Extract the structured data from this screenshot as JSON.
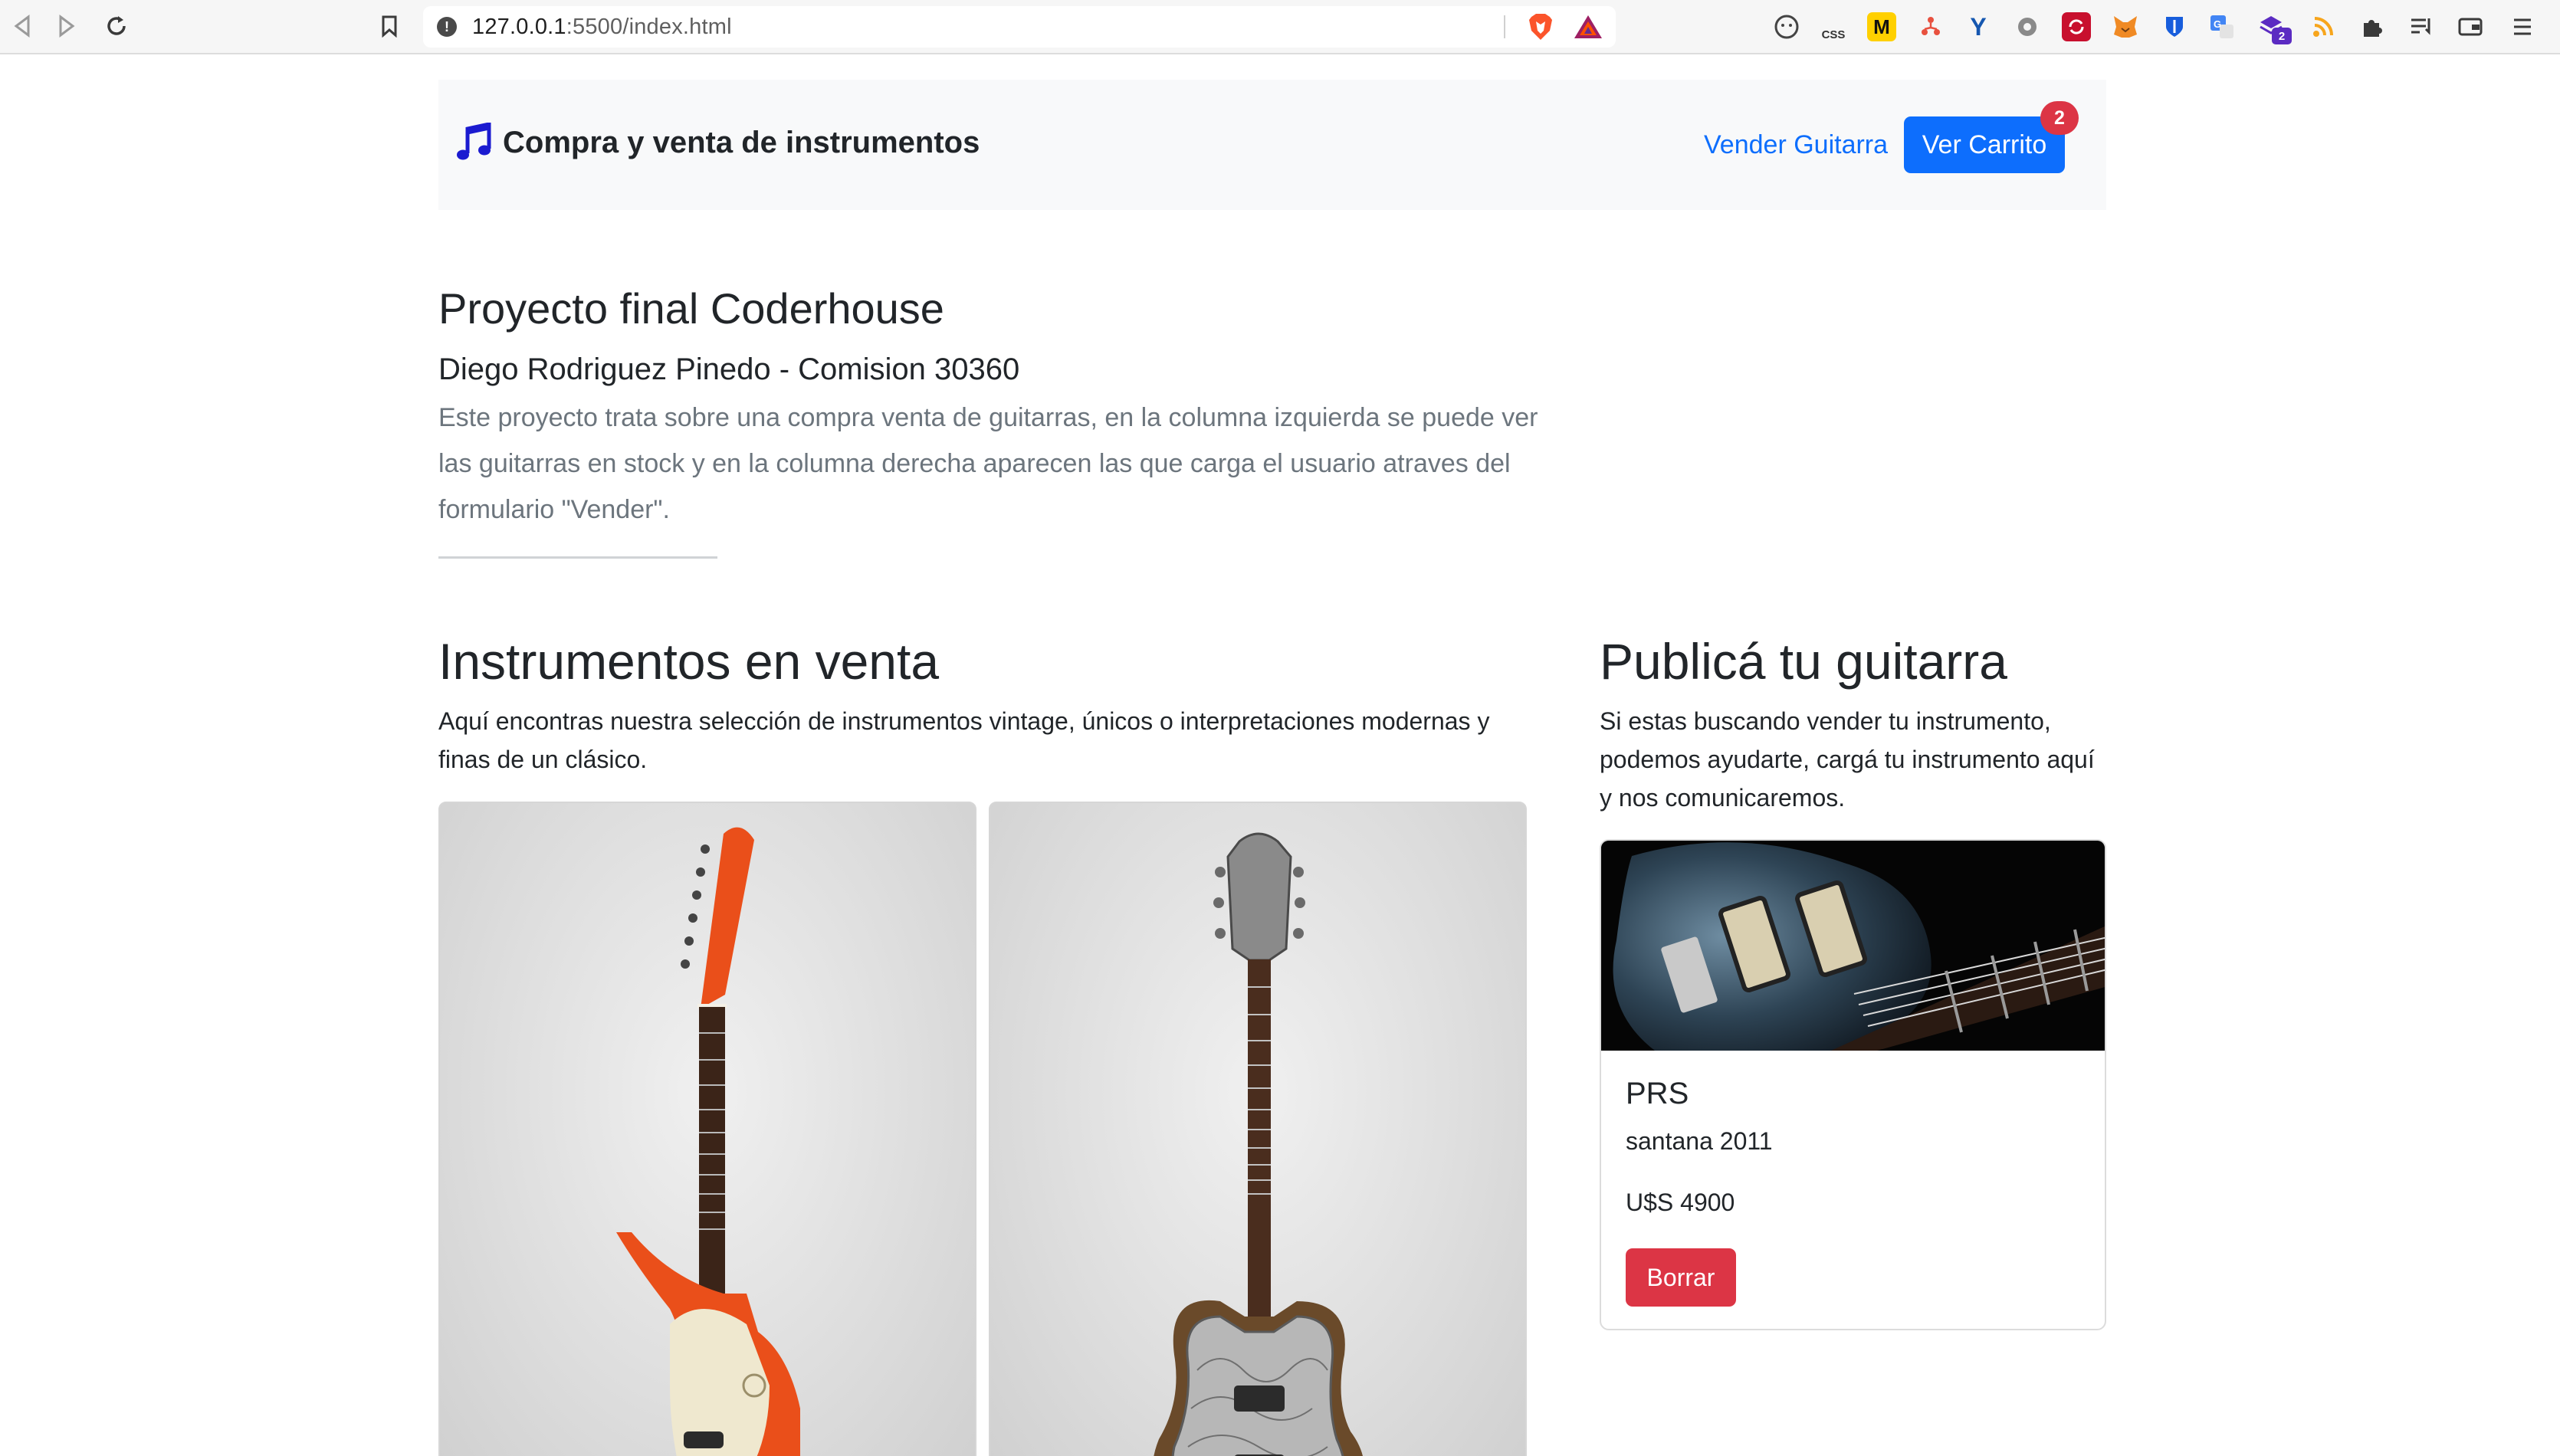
{
  "browser": {
    "url_host": "127.0.0.1",
    "url_rest": ":5500/index.html",
    "extension_badge": "2",
    "css_label": "CSS"
  },
  "navbar": {
    "brand": "Compra y venta de instrumentos",
    "sell_link": "Vender Guitarra",
    "cart_button": "Ver Carrito",
    "cart_count": "2"
  },
  "intro": {
    "title": "Proyecto final Coderhouse",
    "subtitle": "Diego Rodriguez Pinedo - Comision 30360",
    "description": "Este proyecto trata sobre una compra venta de guitarras, en la columna izquierda se puede ver las guitarras en stock y en la columna derecha aparecen las que carga el usuario atraves del formulario \"Vender\"."
  },
  "for_sale": {
    "heading": "Instrumentos en venta",
    "text": "Aquí encontras nuestra selección de instrumentos vintage, únicos o interpretaciones modernas y finas de un clásico."
  },
  "sell": {
    "heading": "Publicá tu guitarra",
    "text": "Si estas buscando vender tu instrumento, podemos ayudarte, cargá tu instrumento aquí y nos comunicaremos.",
    "card": {
      "brand": "PRS",
      "model": "santana 2011",
      "price": "U$S 4900",
      "delete_button": "Borrar"
    }
  },
  "colors": {
    "primary": "#0d6efd",
    "danger": "#dc3545",
    "navbar_bg": "#f8f9fa",
    "muted_text": "#6c757d"
  }
}
